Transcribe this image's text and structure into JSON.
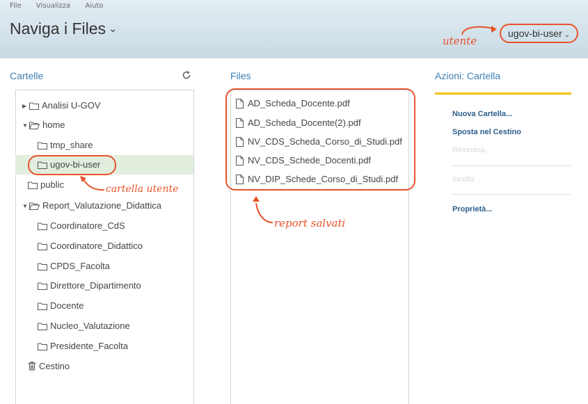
{
  "menu": {
    "file": "File",
    "view": "Visualizza",
    "help": "Aiuto"
  },
  "header": {
    "title": "Naviga i Files",
    "user": "ugov-bi-user"
  },
  "annotations": {
    "user": "utente",
    "user_folder": "cartella utente",
    "saved_reports": "report salvati"
  },
  "folders": {
    "title": "Cartelle",
    "items": [
      {
        "label": "Analisi U-GOV"
      },
      {
        "label": "home"
      },
      {
        "label": "tmp_share"
      },
      {
        "label": "ugov-bi-user"
      },
      {
        "label": "public"
      },
      {
        "label": "Report_Valutazione_Didattica"
      },
      {
        "label": "Coordinatore_CdS"
      },
      {
        "label": "Coordinatore_Didattico"
      },
      {
        "label": "CPDS_Facolta"
      },
      {
        "label": "Direttore_Dipartimento"
      },
      {
        "label": "Docente"
      },
      {
        "label": "Nucleo_Valutazione"
      },
      {
        "label": "Presidente_Facolta"
      },
      {
        "label": "Cestino"
      }
    ]
  },
  "files": {
    "title": "Files",
    "items": [
      "AD_Scheda_Docente.pdf",
      "AD_Scheda_Docente(2).pdf",
      "NV_CDS_Scheda_Corso_di_Studi.pdf",
      "NV_CDS_Schede_Docenti.pdf",
      "NV_DIP_Schede_Corso_di_Studi.pdf"
    ]
  },
  "actions": {
    "title": "Azioni: Cartella",
    "new_folder": "Nuova Cartella...",
    "move_to_trash": "Sposta nel Cestino",
    "rename": "Rinomina...",
    "paste": "Incolla",
    "properties": "Proprietà..."
  },
  "colors": {
    "accent": "#3e7fb3",
    "annotation": "#e8522a",
    "selection": "#e2eedd",
    "action_underline": "#f1c40f"
  }
}
